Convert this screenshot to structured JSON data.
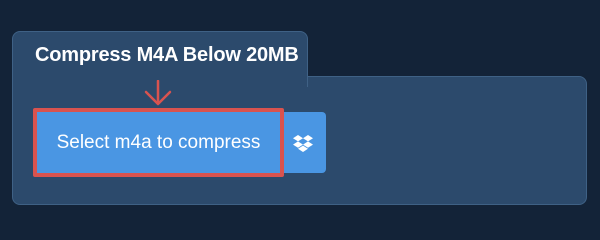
{
  "tab": {
    "title": "Compress M4A Below 20MB"
  },
  "upload": {
    "select_label": "Select m4a to compress",
    "dropbox_icon": "dropbox-icon",
    "annotation_icon": "arrow-down-icon"
  },
  "colors": {
    "background": "#132338",
    "panel": "#2c4a6c",
    "button": "#4a96e3",
    "highlight": "#d9534f"
  }
}
